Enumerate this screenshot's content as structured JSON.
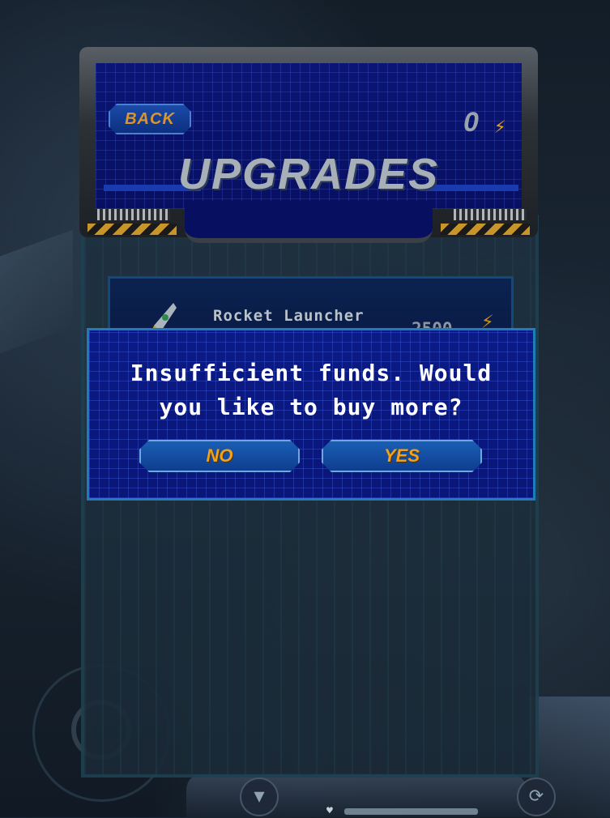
{
  "header": {
    "back_label": "BACK",
    "energy_count": "0",
    "energy_icon": "lightning-bolt-icon",
    "title": "UPGRADES"
  },
  "item": {
    "name": "Rocket Launcher",
    "price": "2500",
    "price_icon": "lightning-bolt-icon",
    "icon": "rocket-icon"
  },
  "dialog": {
    "message_line1": "Insufficient funds. Would",
    "message_line2": "you like to buy more?",
    "no_label": "NO",
    "yes_label": "YES"
  },
  "colors": {
    "screen_blue": "#0a1575",
    "accent_orange": "#f0a21a",
    "dialog_border": "#1e7cb8"
  }
}
